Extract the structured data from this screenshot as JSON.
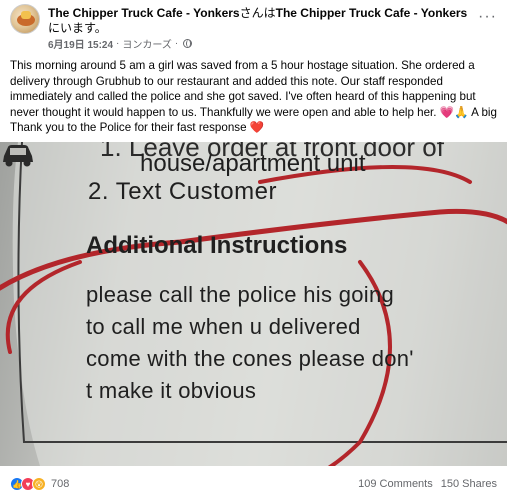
{
  "post": {
    "page_name": "The Chipper Truck Cafe - Yonkers",
    "sa_n_ha": "さんは",
    "shared_page": "The Chipper Truck Cafe - Yonkers",
    "ni_imasu": "にいます。",
    "date": "6月19日 15:24",
    "separator": "·",
    "location": "ヨンカーズ",
    "separator2": "·",
    "body": "This morning around 5 am a girl was saved from a 5 hour hostage situation. She ordered a delivery through Grubhub to our restaurant and added this note.  Our staff responded immediately and called the police and she got saved. I've often heard of this happening but never thought it would happen to us. Thankfully we were open and able to help her.  💗🙏 A big Thank you to the Police for their fast response ❤️",
    "more_label": "···"
  },
  "photo": {
    "line1": "1. Leave order at front door of",
    "line2": "house/apartment unit",
    "line3": "2. Text Customer",
    "heading": "Additional Instructions",
    "note1": "please call the police his going",
    "note2": "to call me when u delivered",
    "note3": "come with the cones please don'",
    "note4": "t make it obvious"
  },
  "footer": {
    "reaction_count": "708",
    "comments": "109 Comments",
    "shares": "150 Shares"
  },
  "colors": {
    "circle_red": "#b3262b",
    "like_blue": "#1877f2",
    "love_red": "#f33e58",
    "wow_yellow": "#f7b125"
  }
}
